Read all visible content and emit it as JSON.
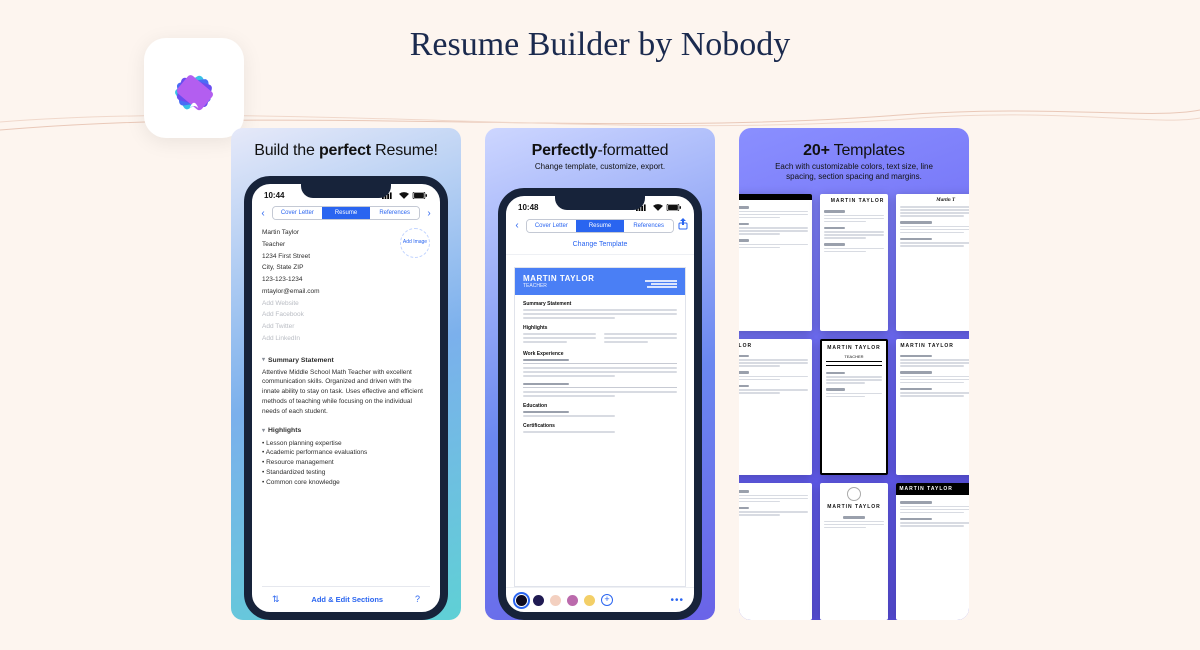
{
  "page_title": "Resume Builder by Nobody",
  "panel1": {
    "headline_pre": "Build the ",
    "headline_bold": "perfect",
    "headline_post": " Resume!",
    "time": "10:44",
    "tabs": [
      "Cover Letter",
      "Resume",
      "References"
    ],
    "active_tab": "Resume",
    "name": "Martin Taylor",
    "role": "Teacher",
    "addr1": "1234 First Street",
    "addr2": "City, State ZIP",
    "phone": "123-123-1234",
    "email": "mtaylor@email.com",
    "add_image": "Add Image",
    "socials": [
      "Add Website",
      "Add Facebook",
      "Add Twitter",
      "Add LinkedIn"
    ],
    "summary_head": "Summary Statement",
    "summary_body": "Attentive Middle School Math Teacher with excellent communication skills. Organized and driven with the innate ability to stay on task. Uses effective and efficient methods of teaching while focusing on the individual needs of each student.",
    "highlights_head": "Highlights",
    "highlights": [
      "Lesson planning expertise",
      "Academic performance evaluations",
      "Resource management",
      "Standardized testing",
      "Common core knowledge"
    ],
    "bottom_action": "Add & Edit Sections"
  },
  "panel2": {
    "headline_bold": "Perfectly",
    "headline_post": "-formatted",
    "sub": "Change template, customize, export.",
    "time": "10:48",
    "tabs": [
      "Cover Letter",
      "Resume",
      "References"
    ],
    "active_tab": "Resume",
    "change_template": "Change Template",
    "doc_name": "MARTIN TAYLOR",
    "doc_title": "TEACHER",
    "sections": [
      "Summary Statement",
      "Highlights",
      "Work Experience",
      "Education",
      "Certifications"
    ],
    "swatches": [
      "#0e0b20",
      "#1f1a52",
      "#f3d0c0",
      "#bb6aac",
      "#f3cf67"
    ]
  },
  "panel3": {
    "headline_bold": "20+",
    "headline_post": " Templates",
    "sub": "Each with customizable colors, text size, line spacing, section spacing and margins.",
    "tpl_name": "MARTIN TAYLOR",
    "tpl_name_short": "R. TAYLOR",
    "tpl_serif": "Martin T",
    "tpl_sub": "TEACHER"
  }
}
